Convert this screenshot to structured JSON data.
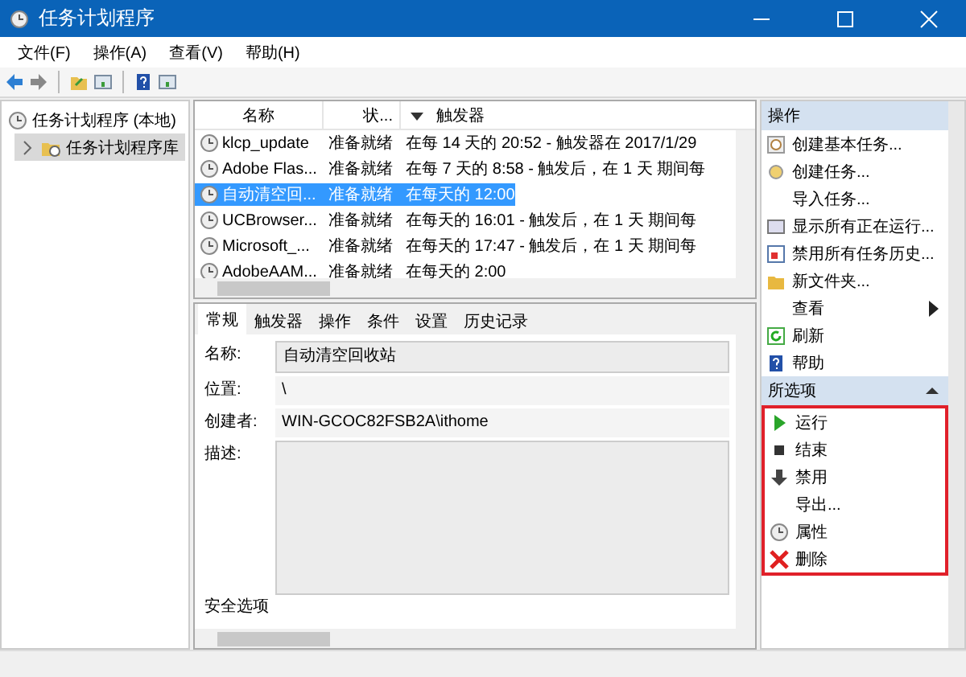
{
  "window": {
    "title": "任务计划程序"
  },
  "menu": [
    "文件(F)",
    "操作(A)",
    "查看(V)",
    "帮助(H)"
  ],
  "tree": [
    {
      "label": "任务计划程序 (本地)",
      "selected": false,
      "children": [
        {
          "label": "任务计划程序库",
          "selected": true,
          "expanded": false
        }
      ]
    }
  ],
  "task_list": {
    "columns": [
      {
        "label": "名称",
        "sorted": false
      },
      {
        "label": "状...",
        "sorted": false
      },
      {
        "label": "触发器",
        "sorted": true
      }
    ],
    "rows": [
      {
        "name": "klcp_update",
        "status": "准备就绪",
        "trigger": "在每 14 天的 20:52 - 触发器在 2017/1/29",
        "selected": false
      },
      {
        "name": "Adobe Flas...",
        "status": "准备就绪",
        "trigger": "在每 7 天的 8:58 - 触发后，在 1 天 期间每",
        "selected": false
      },
      {
        "name": "自动清空回...",
        "status": "准备就绪",
        "trigger": "在每天的 12:00",
        "selected": true
      },
      {
        "name": "UCBrowser...",
        "status": "准备就绪",
        "trigger": "在每天的 16:01 - 触发后，在 1 天 期间每",
        "selected": false
      },
      {
        "name": "Microsoft_...",
        "status": "准备就绪",
        "trigger": "在每天的 17:47 - 触发后，在 1 天 期间每",
        "selected": false
      },
      {
        "name": "AdobeAAM...",
        "status": "准备就绪",
        "trigger": "在每天的 2:00",
        "selected": false
      }
    ]
  },
  "details": {
    "tabs": [
      {
        "label": "常规",
        "selected": true
      },
      {
        "label": "触发器",
        "selected": false
      },
      {
        "label": "操作",
        "selected": false
      },
      {
        "label": "条件",
        "selected": false
      },
      {
        "label": "设置",
        "selected": false
      },
      {
        "label": "历史记录",
        "selected": false
      }
    ],
    "fields": [
      {
        "label": "名称:",
        "kind": "field",
        "value": "自动清空回收站"
      },
      {
        "label": "位置:",
        "kind": "text",
        "value": "\\"
      },
      {
        "label": "创建者:",
        "kind": "text",
        "value": "WIN-GCOC82FSB2A\\ithome"
      },
      {
        "label": "描述:",
        "kind": "area"
      }
    ],
    "section": "安全选项"
  },
  "actions": [
    {
      "title": "操作",
      "highlighted": false,
      "items": [
        {
          "label": "创建基本任务...",
          "submenu": false
        },
        {
          "label": "创建任务...",
          "submenu": false
        },
        {
          "label": "导入任务...",
          "submenu": false
        },
        {
          "label": "显示所有正在运行...",
          "submenu": false
        },
        {
          "label": "禁用所有任务历史...",
          "submenu": false
        },
        {
          "label": "新文件夹...",
          "submenu": false
        },
        {
          "label": "查看",
          "submenu": true
        },
        {
          "label": "刷新",
          "submenu": false
        },
        {
          "label": "帮助",
          "submenu": false
        }
      ]
    },
    {
      "title": "所选项",
      "highlighted": true,
      "items": [
        {
          "label": "运行",
          "submenu": false
        },
        {
          "label": "结束",
          "submenu": false
        },
        {
          "label": "禁用",
          "submenu": false
        },
        {
          "label": "导出...",
          "submenu": false
        },
        {
          "label": "属性",
          "submenu": false
        },
        {
          "label": "删除",
          "submenu": false
        }
      ]
    }
  ]
}
